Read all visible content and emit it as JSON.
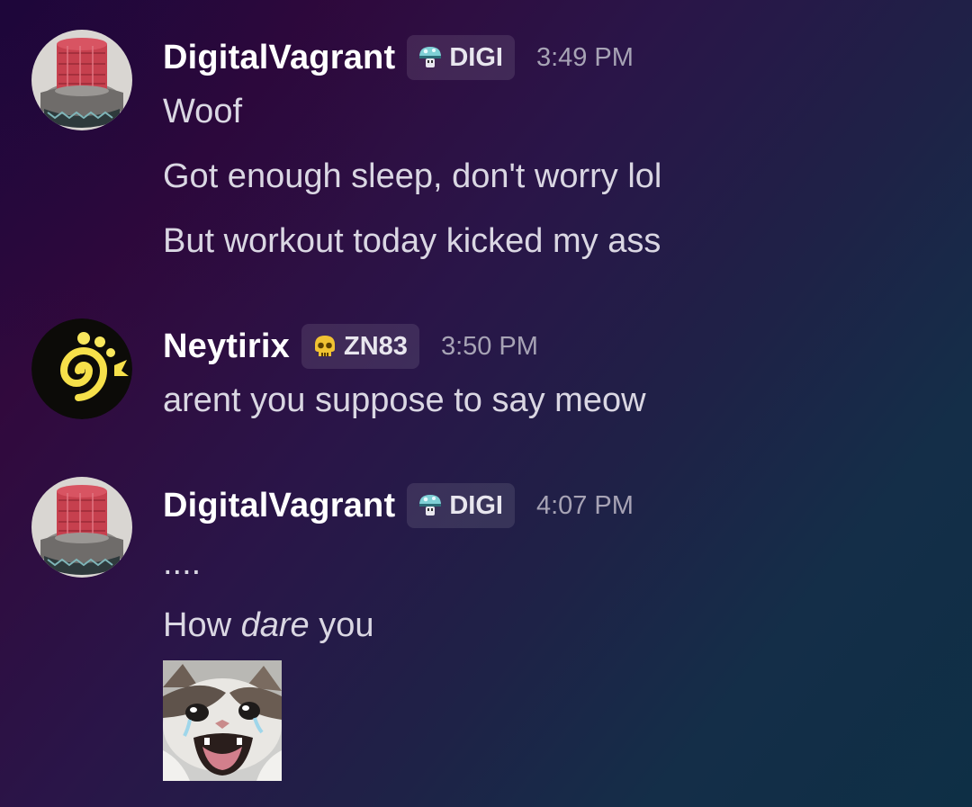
{
  "messages": [
    {
      "author": "DigitalVagrant",
      "tag": "DIGI",
      "tag_icon": "mushroom-icon",
      "time": "3:49 PM",
      "lines": [
        "Woof",
        "Got enough sleep, don't worry lol",
        "But workout today kicked my ass"
      ]
    },
    {
      "author": "Neytirix",
      "tag": "ZN83",
      "tag_icon": "skull-icon",
      "time": "3:50 PM",
      "lines": [
        "arent you suppose to say meow"
      ]
    },
    {
      "author": "DigitalVagrant",
      "tag": "DIGI",
      "tag_icon": "mushroom-icon",
      "time": "4:07 PM",
      "lines": [
        "....",
        "How ",
        "dare",
        " you"
      ],
      "sticker": "crying-cat-sticker"
    }
  ],
  "colors": {
    "username": "#ffffff",
    "text": "#dad7e3",
    "timestamp": "#a7a3b5",
    "tag_bg": "rgba(255,255,255,0.10)"
  }
}
